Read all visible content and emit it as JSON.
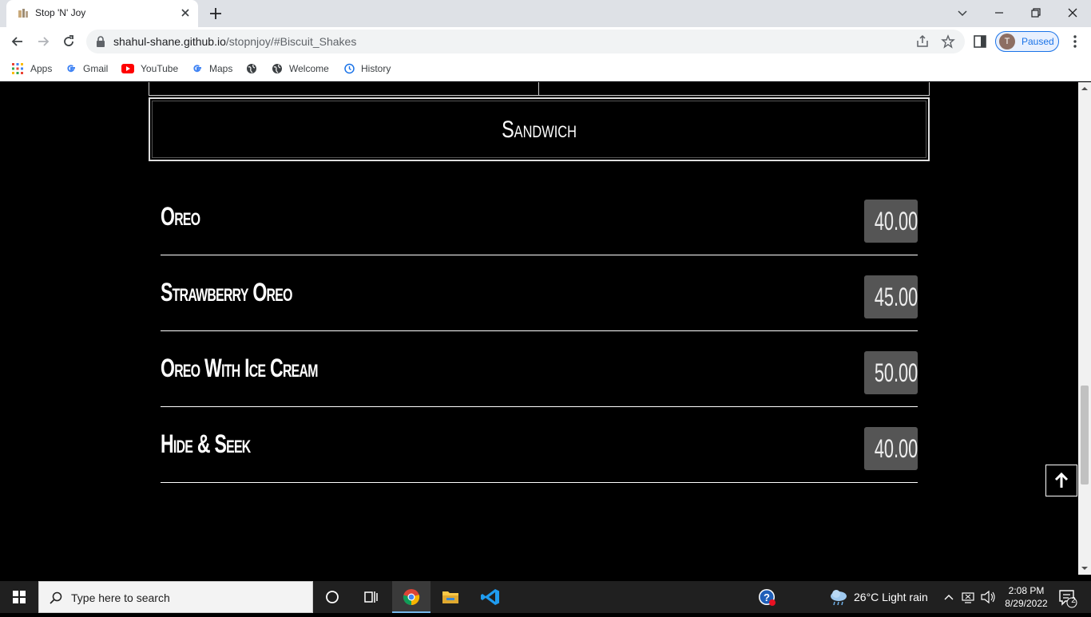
{
  "browser": {
    "tab_title": "Stop 'N' Joy",
    "url_host": "shahul-shane.github.io",
    "url_path": "/stopnjoy/#Biscuit_Shakes",
    "profile_initial": "T",
    "profile_status": "Paused"
  },
  "bookmarks": [
    {
      "label": "Apps",
      "icon": "apps-grid-icon"
    },
    {
      "label": "Gmail",
      "icon": "google-icon"
    },
    {
      "label": "YouTube",
      "icon": "youtube-icon"
    },
    {
      "label": "Maps",
      "icon": "google-icon"
    },
    {
      "label": "",
      "icon": "globe-icon"
    },
    {
      "label": "Welcome",
      "icon": "globe-icon"
    },
    {
      "label": "History",
      "icon": "history-icon"
    }
  ],
  "page": {
    "section_title": "Sandwich",
    "items": [
      {
        "name": "Oreo",
        "price": "40.00"
      },
      {
        "name": "Strawberry Oreo",
        "price": "45.00"
      },
      {
        "name": "Oreo With Ice Cream",
        "price": "50.00"
      },
      {
        "name": "Hide & Seek",
        "price": "40.00"
      }
    ]
  },
  "taskbar": {
    "search_placeholder": "Type here to search",
    "weather": "26°C  Light rain",
    "time": "2:08 PM",
    "date": "8/29/2022",
    "notification_count": "2"
  }
}
